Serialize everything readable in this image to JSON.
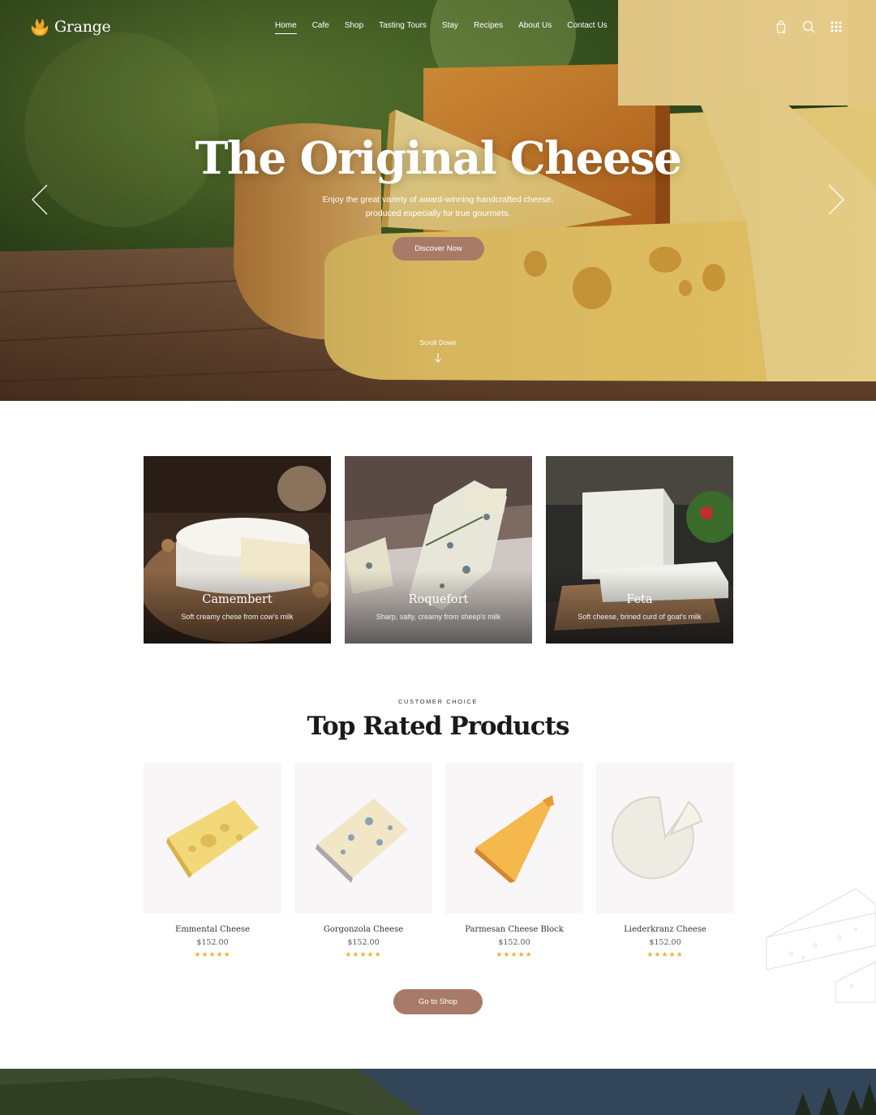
{
  "brand": {
    "name": "Grange",
    "accent": "#a87a68",
    "star_color": "#e7b436"
  },
  "nav": {
    "items": [
      {
        "label": "Home",
        "active": true
      },
      {
        "label": "Cafe"
      },
      {
        "label": "Shop"
      },
      {
        "label": "Tasting Tours"
      },
      {
        "label": "Stay"
      },
      {
        "label": "Recipes"
      },
      {
        "label": "About Us"
      },
      {
        "label": "Contact Us"
      }
    ],
    "icons": [
      "cart-icon",
      "search-icon",
      "grid-menu-icon"
    ],
    "cart_count": "0"
  },
  "hero": {
    "title": "The Original Cheese",
    "subtitle_line1": "Enjoy the great variety of award-winning handcrafted cheese,",
    "subtitle_line2": "produced especially for true gourmets.",
    "button": "Discover Now",
    "scroll": "Scroll Down"
  },
  "categories": [
    {
      "title": "Camembert",
      "subtitle": "Soft creamy chese from cow's milk"
    },
    {
      "title": "Roquefort",
      "subtitle": "Sharp, salty, creamy from sheep's milk"
    },
    {
      "title": "Feta",
      "subtitle": "Soft cheese, brined curd of goat's milk"
    }
  ],
  "top_rated": {
    "eyebrow": "CUSTOMER CHOICE",
    "title": "Top Rated Products",
    "products": [
      {
        "name": "Emmental Cheese",
        "price": "$152.00",
        "rating": 5,
        "stars": "★★★★★"
      },
      {
        "name": "Gorgonzola Cheese",
        "price": "$152.00",
        "rating": 5,
        "stars": "★★★★★"
      },
      {
        "name": "Parmesan Cheese Block",
        "price": "$152.00",
        "rating": 5,
        "stars": "★★★★★"
      },
      {
        "name": "Liederkranz Cheese",
        "price": "$152.00",
        "rating": 5,
        "stars": "★★★★★"
      }
    ],
    "button": "Go to Shop"
  }
}
